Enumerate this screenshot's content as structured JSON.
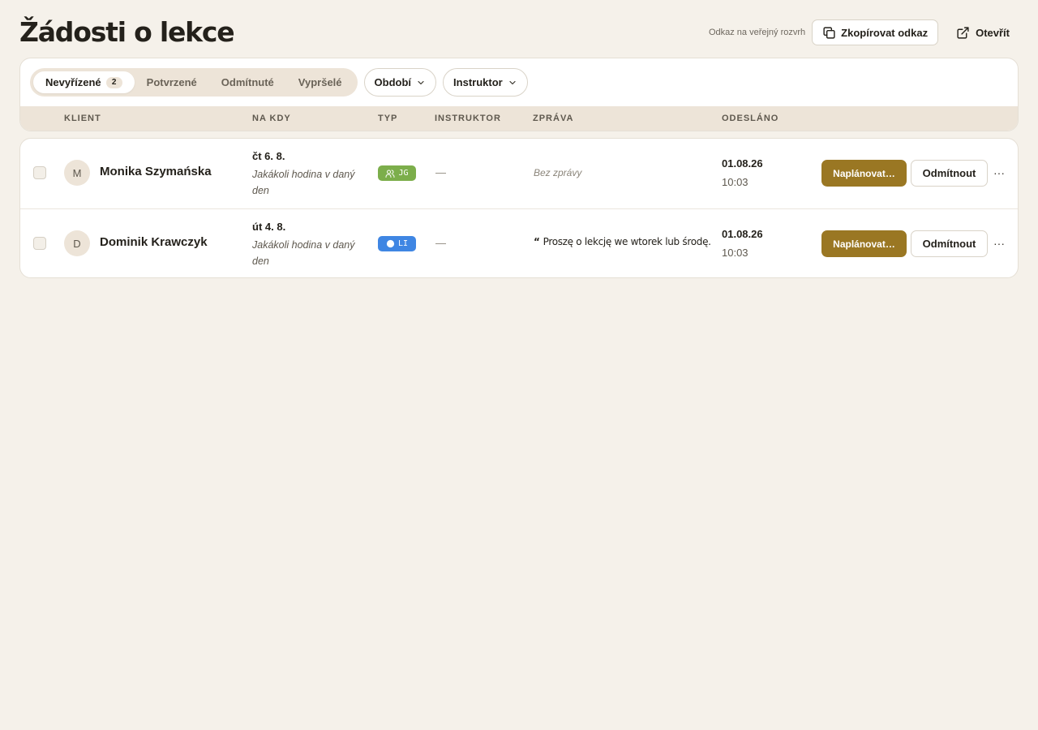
{
  "page": {
    "title": "Žádosti o lekce"
  },
  "header": {
    "public_link_label": "Odkaz na veřejný rozvrh",
    "copy_link_label": "Zkopírovat odkaz",
    "open_label": "Otevřít"
  },
  "filters": {
    "tabs": [
      {
        "label": "Nevyřízené",
        "count": "2",
        "active": true
      },
      {
        "label": "Potvrzené"
      },
      {
        "label": "Odmítnuté"
      },
      {
        "label": "Vypršelé"
      }
    ],
    "period_label": "Období",
    "instructor_label": "Instruktor"
  },
  "table": {
    "headers": {
      "client": "KLIENT",
      "when": "NA KDY",
      "type": "TYP",
      "instructor": "INSTRUKTOR",
      "message": "ZPRÁVA",
      "sent": "ODESLÁNO"
    },
    "rows": [
      {
        "initial": "M",
        "client": "Monika Szymańska",
        "date": "čt 6. 8.",
        "time_note": "Jakákoli hodina v daný den",
        "type_code": "JG",
        "type_icon": "users-icon",
        "type_color": "#7cae4b",
        "instructor": "—",
        "message": "Bez zprávy",
        "message_empty": true,
        "sent_date": "01.08.26",
        "sent_time": "10:03",
        "schedule_label": "Naplánovat…",
        "reject_label": "Odmítnout",
        "more_label": "···"
      },
      {
        "initial": "D",
        "client": "Dominik Krawczyk",
        "date": "út 4. 8.",
        "time_note": "Jakákoli hodina v daný den",
        "type_code": "LI",
        "type_icon": "person-icon",
        "type_color": "#3f86e3",
        "instructor": "—",
        "quote_mark": "“",
        "message": "Proszę o lekcję we wtorek lub środę.",
        "message_empty": false,
        "sent_date": "01.08.26",
        "sent_time": "10:03",
        "schedule_label": "Naplánovat…",
        "reject_label": "Odmítnout",
        "more_label": "···"
      }
    ]
  },
  "colors": {
    "background": "#f5f1ea",
    "accent": "#9a7723",
    "tint": "#ede4d8"
  }
}
